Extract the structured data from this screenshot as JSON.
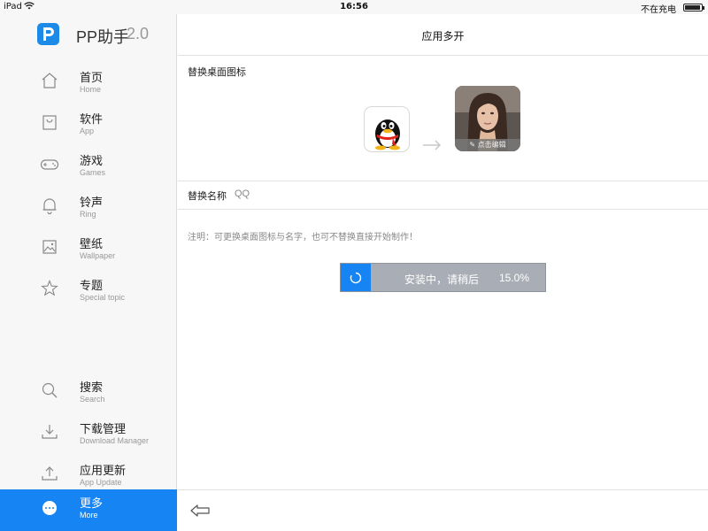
{
  "status_bar": {
    "device": "iPad",
    "time": "16:56",
    "charging": "不在充电",
    "battery_level": 0.9
  },
  "brand": {
    "name": "PP助手",
    "version": "2.0",
    "logo_icon": "pp-logo-icon",
    "accent": "#1784f4"
  },
  "nav": [
    {
      "zh": "首页",
      "en": "Home",
      "icon": "home-icon"
    },
    {
      "zh": "软件",
      "en": "App",
      "icon": "app-bag-icon"
    },
    {
      "zh": "游戏",
      "en": "Games",
      "icon": "gamepad-icon"
    },
    {
      "zh": "铃声",
      "en": "Ring",
      "icon": "bell-icon"
    },
    {
      "zh": "壁纸",
      "en": "Wallpaper",
      "icon": "picture-icon"
    },
    {
      "zh": "专题",
      "en": "Special topic",
      "icon": "star-icon"
    }
  ],
  "nav_bottom": [
    {
      "zh": "搜索",
      "en": "Search",
      "icon": "search-icon"
    },
    {
      "zh": "下载管理",
      "en": "Download Manager",
      "icon": "download-icon"
    },
    {
      "zh": "应用更新",
      "en": "App Update",
      "icon": "upload-icon"
    },
    {
      "zh": "更多",
      "en": "More",
      "icon": "more-icon",
      "active": true
    }
  ],
  "main": {
    "title": "应用多开",
    "replace_icon_label": "替换桌面图标",
    "edit_label": "点击编辑",
    "replace_name_label": "替换名称",
    "name_value": "QQ",
    "note": "注明：可更换桌面图标与名字，也可不替换直接开始制作！",
    "install_text": "安装中，请稍后",
    "install_progress": "15.0%"
  }
}
